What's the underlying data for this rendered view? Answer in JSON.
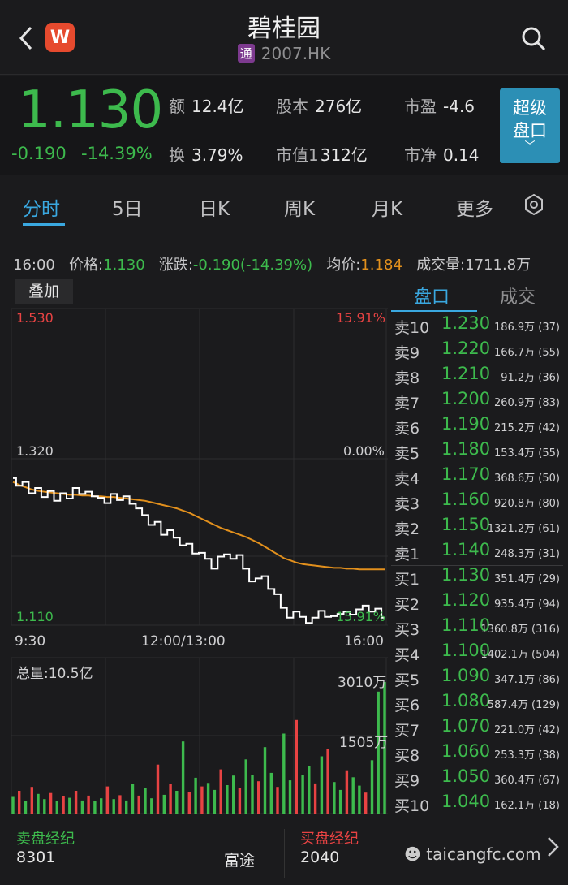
{
  "header": {
    "title": "碧桂园",
    "badge": "通",
    "code": "2007.HK"
  },
  "quote": {
    "price": "1.130",
    "change": "-0.190",
    "change_pct": "-14.39%",
    "stats": [
      {
        "k": "额",
        "v": "12.4亿"
      },
      {
        "k": "股本",
        "v": "276亿"
      },
      {
        "k": "市盈",
        "v": "-4.6"
      },
      {
        "k": "换",
        "v": "3.79%"
      },
      {
        "k": "市值1",
        "v": "312亿"
      },
      {
        "k": "市净",
        "v": "0.14"
      }
    ],
    "super_button": {
      "line1": "超级",
      "line2": "盘口",
      "chev": "﹀"
    }
  },
  "tabs": [
    "分时",
    "5日",
    "日K",
    "周K",
    "月K",
    "更多"
  ],
  "active_tab": "分时",
  "infoline": {
    "time": "16:00",
    "price_label": "价格:",
    "price": "1.130",
    "chg_label": "涨跌:",
    "chg": "-0.190(-14.39%)",
    "avg_label": "均价:",
    "avg": "1.184",
    "vol_label": "成交量:",
    "vol": "1711.8万"
  },
  "chart": {
    "overlay_button": "叠加",
    "y_top_left": "1.530",
    "y_top_right": "15.91%",
    "y_mid_left": "1.320",
    "y_mid_right": "0.00%",
    "y_bot_left": "1.110",
    "y_bot_right": "15.91%",
    "x_labels": [
      "9:30",
      "12:00/13:00",
      "16:00"
    ],
    "vol_label": "总量:10.5亿",
    "vol_top": "3010万",
    "vol_mid": "1505万",
    "colors": {
      "up": "#e84343",
      "down": "#3dba4d",
      "avg_line": "#e2901d",
      "price_line": "#ffffff"
    }
  },
  "chart_data": {
    "type": "line",
    "ylim": [
      1.11,
      1.53
    ],
    "price": [
      1.305,
      1.295,
      1.3,
      1.285,
      1.292,
      1.28,
      1.288,
      1.275,
      1.285,
      1.278,
      1.292,
      1.284,
      1.287,
      1.281,
      1.279,
      1.272,
      1.284,
      1.276,
      1.281,
      1.271,
      1.265,
      1.256,
      1.243,
      1.247,
      1.23,
      1.236,
      1.226,
      1.216,
      1.218,
      1.205,
      1.206,
      1.198,
      1.185,
      1.201,
      1.204,
      1.198,
      1.203,
      1.185,
      1.168,
      1.172,
      1.175,
      1.158,
      1.151,
      1.133,
      1.12,
      1.128,
      1.121,
      1.113,
      1.12,
      1.129,
      1.121,
      1.122,
      1.125,
      1.128,
      1.124,
      1.131,
      1.136,
      1.128,
      1.132,
      1.12
    ],
    "avg": [
      1.3,
      1.296,
      1.293,
      1.29,
      1.288,
      1.287,
      1.286,
      1.285,
      1.284,
      1.283,
      1.283,
      1.282,
      1.282,
      1.281,
      1.281,
      1.28,
      1.28,
      1.279,
      1.278,
      1.277,
      1.276,
      1.275,
      1.273,
      1.271,
      1.269,
      1.267,
      1.265,
      1.262,
      1.259,
      1.255,
      1.251,
      1.247,
      1.243,
      1.239,
      1.236,
      1.233,
      1.23,
      1.227,
      1.223,
      1.219,
      1.214,
      1.209,
      1.204,
      1.199,
      1.196,
      1.193,
      1.191,
      1.19,
      1.189,
      1.188,
      1.187,
      1.186,
      1.186,
      1.185,
      1.185,
      1.184,
      1.184,
      1.184,
      1.184,
      1.184
    ],
    "volume": [
      380,
      520,
      290,
      610,
      450,
      330,
      470,
      290,
      400,
      360,
      520,
      300,
      410,
      280,
      350,
      620,
      330,
      420,
      300,
      680,
      410,
      590,
      350,
      1120,
      430,
      680,
      520,
      1650,
      490,
      820,
      620,
      700,
      540,
      1010,
      650,
      870,
      590,
      1240,
      880,
      740,
      1520,
      930,
      610,
      1830,
      760,
      2140,
      880,
      1090,
      690,
      1310,
      1470,
      720,
      540,
      990,
      830,
      640,
      480,
      1220,
      2790,
      3010
    ],
    "volume_up": [
      false,
      true,
      false,
      true,
      false,
      false,
      true,
      false,
      true,
      false,
      true,
      false,
      true,
      false,
      false,
      true,
      false,
      true,
      false,
      false,
      true,
      false,
      false,
      true,
      false,
      true,
      false,
      false,
      true,
      false,
      true,
      false,
      false,
      true,
      false,
      false,
      true,
      false,
      false,
      true,
      false,
      false,
      true,
      false,
      false,
      true,
      false,
      false,
      true,
      false,
      true,
      false,
      false,
      true,
      false,
      false,
      true,
      false,
      false,
      false
    ]
  },
  "book": {
    "tabs": [
      "盘口",
      "成交"
    ],
    "asks": [
      {
        "side": "卖10",
        "price": "1.230",
        "vol": "186.9万 (37)"
      },
      {
        "side": "卖9",
        "price": "1.220",
        "vol": "166.7万 (55)"
      },
      {
        "side": "卖8",
        "price": "1.210",
        "vol": "91.2万 (36)"
      },
      {
        "side": "卖7",
        "price": "1.200",
        "vol": "260.9万 (83)"
      },
      {
        "side": "卖6",
        "price": "1.190",
        "vol": "215.2万 (42)"
      },
      {
        "side": "卖5",
        "price": "1.180",
        "vol": "153.4万 (55)"
      },
      {
        "side": "卖4",
        "price": "1.170",
        "vol": "368.6万 (50)"
      },
      {
        "side": "卖3",
        "price": "1.160",
        "vol": "920.8万 (80)"
      },
      {
        "side": "卖2",
        "price": "1.150",
        "vol": "1321.2万 (61)"
      },
      {
        "side": "卖1",
        "price": "1.140",
        "vol": "248.3万 (31)"
      }
    ],
    "bids": [
      {
        "side": "买1",
        "price": "1.130",
        "vol": "351.4万 (29)"
      },
      {
        "side": "买2",
        "price": "1.120",
        "vol": "935.4万 (94)"
      },
      {
        "side": "买3",
        "price": "1.110",
        "vol": "1360.8万 (316)"
      },
      {
        "side": "买4",
        "price": "1.100",
        "vol": "1402.1万 (504)"
      },
      {
        "side": "买5",
        "price": "1.090",
        "vol": "347.1万 (86)"
      },
      {
        "side": "买6",
        "price": "1.080",
        "vol": "587.4万 (129)"
      },
      {
        "side": "买7",
        "price": "1.070",
        "vol": "221.0万 (42)"
      },
      {
        "side": "买8",
        "price": "1.060",
        "vol": "253.3万 (38)"
      },
      {
        "side": "买9",
        "price": "1.050",
        "vol": "360.4万 (67)"
      },
      {
        "side": "买10",
        "price": "1.040",
        "vol": "162.1万 (18)"
      }
    ]
  },
  "footer": {
    "sell_title": "卖盘经纪",
    "sell_code": "8301",
    "sell_name": "富途",
    "buy_title": "买盘经纪",
    "buy_code": "2040",
    "watermark": "taicangfc.com"
  }
}
